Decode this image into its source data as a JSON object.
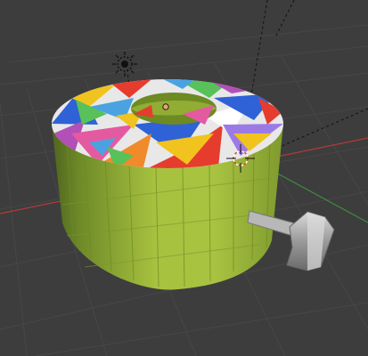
{
  "viewport": {
    "type": "3d-viewport",
    "background": "#3d3d3d",
    "grid_color": "#474747",
    "x_axis_color": "#b33a3a",
    "y_axis_color": "#3f8c3f"
  },
  "scene": {
    "object": {
      "name": "cylinder",
      "color": "#9bb53a",
      "cap_texture": "multicolor-triangles",
      "palette": [
        "#e63c2e",
        "#f0c31e",
        "#2f62d6",
        "#4aa3e0",
        "#b34fb8",
        "#58c15a",
        "#e45aa0",
        "#f08a2a",
        "#9c7ae6",
        "#ffffff"
      ]
    },
    "light": {
      "icon": "sun-lamp-icon"
    },
    "empty": {
      "icon": "origin-dot-icon"
    },
    "camera": {
      "icon": "camera-icon"
    },
    "cursor_3d": {
      "icon": "3d-cursor-icon"
    }
  }
}
